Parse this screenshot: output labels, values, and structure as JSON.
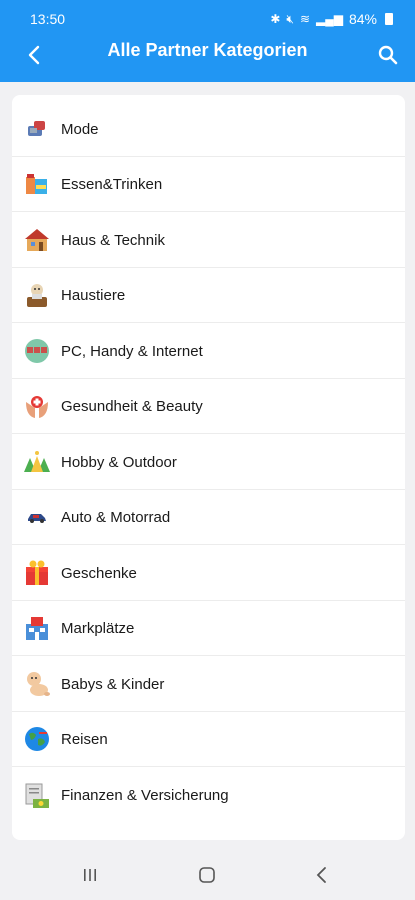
{
  "status_bar": {
    "time": "13:50",
    "battery": "84%"
  },
  "header": {
    "title": "Alle Partner Kategorien"
  },
  "categories": [
    {
      "label": "Mode",
      "icon": "clothes-icon"
    },
    {
      "label": "Essen&Trinken",
      "icon": "food-icon"
    },
    {
      "label": "Haus & Technik",
      "icon": "house-icon"
    },
    {
      "label": "Haustiere",
      "icon": "pet-icon"
    },
    {
      "label": "PC, Handy & Internet",
      "icon": "globe-devices-icon"
    },
    {
      "label": "Gesundheit & Beauty",
      "icon": "health-hands-icon"
    },
    {
      "label": "Hobby & Outdoor",
      "icon": "camping-icon"
    },
    {
      "label": "Auto & Motorrad",
      "icon": "car-icon"
    },
    {
      "label": "Geschenke",
      "icon": "gift-icon"
    },
    {
      "label": "Markplätze",
      "icon": "marketplace-icon"
    },
    {
      "label": "Babys & Kinder",
      "icon": "baby-icon"
    },
    {
      "label": "Reisen",
      "icon": "globe-travel-icon"
    },
    {
      "label": "Finanzen & Versicherung",
      "icon": "finance-icon"
    }
  ],
  "colors": {
    "appbar": "#2196f3",
    "background": "#f1f1f3",
    "card": "#ffffff"
  }
}
